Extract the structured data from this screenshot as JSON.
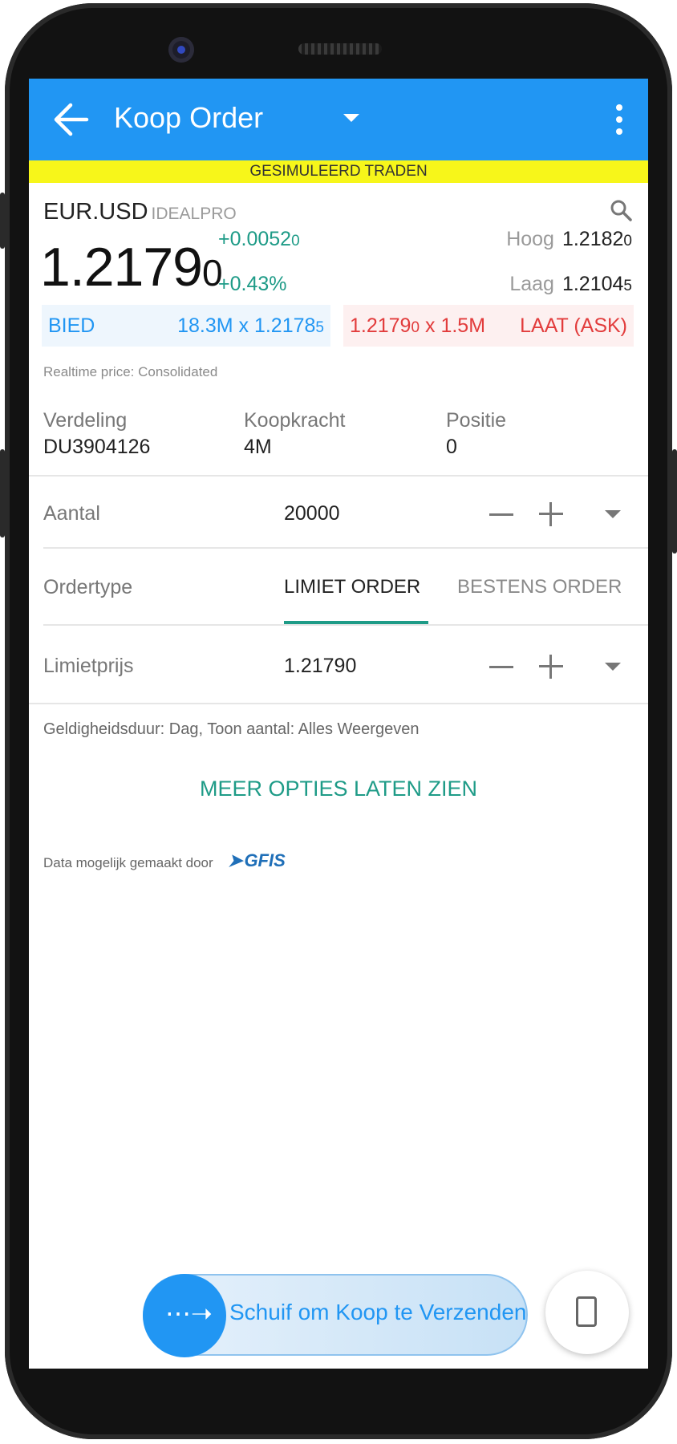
{
  "appbar": {
    "title": "Koop Order"
  },
  "banner": {
    "text": "GESIMULEERD TRADEN"
  },
  "instrument": {
    "symbol": "EUR.USD",
    "exchange": "IDEALPRO",
    "price_main": "1.2179",
    "price_small": "0",
    "change_main": "+0.0052",
    "change_small": "0",
    "change_pct": "+0.43%",
    "high_label": "Hoog",
    "high_main": "1.2182",
    "high_small": "0",
    "low_label": "Laag",
    "low_main": "1.2104",
    "low_small": "5"
  },
  "quote": {
    "bid_label": "BIED",
    "bid_value_main": "18.3M x 1.2178",
    "bid_value_small": "5",
    "ask_value_main": "1.2179",
    "ask_value_small": "0",
    "ask_value_rest": " x 1.5M",
    "ask_label": "LAAT (ASK)"
  },
  "realtime": "Realtime price: Consolidated",
  "account": [
    {
      "key": "Verdeling",
      "value": "DU3904126"
    },
    {
      "key": "Koopkracht",
      "value": "4M"
    },
    {
      "key": "Positie",
      "value": "0"
    }
  ],
  "order": {
    "quantity_label": "Aantal",
    "quantity_value": "20000",
    "ordertype_label": "Ordertype",
    "tab_limit": "LIMIET ORDER",
    "tab_market": "BESTENS ORDER",
    "limitprice_label": "Limietprijs",
    "limitprice_value": "1.21790"
  },
  "validity": "Geldigheidsduur: Dag, Toon aantal: Alles Weergeven",
  "more_options": "MEER OPTIES LATEN ZIEN",
  "data_provider": {
    "text": "Data mogelijk gemaakt door",
    "logo": "GFIS"
  },
  "slider": {
    "text": "Schuif om Koop te Verzenden"
  },
  "colors": {
    "appbar": "#2196f3",
    "accent": "#1e9b87",
    "ask": "#e23c3c",
    "banner": "#f7f61a"
  }
}
